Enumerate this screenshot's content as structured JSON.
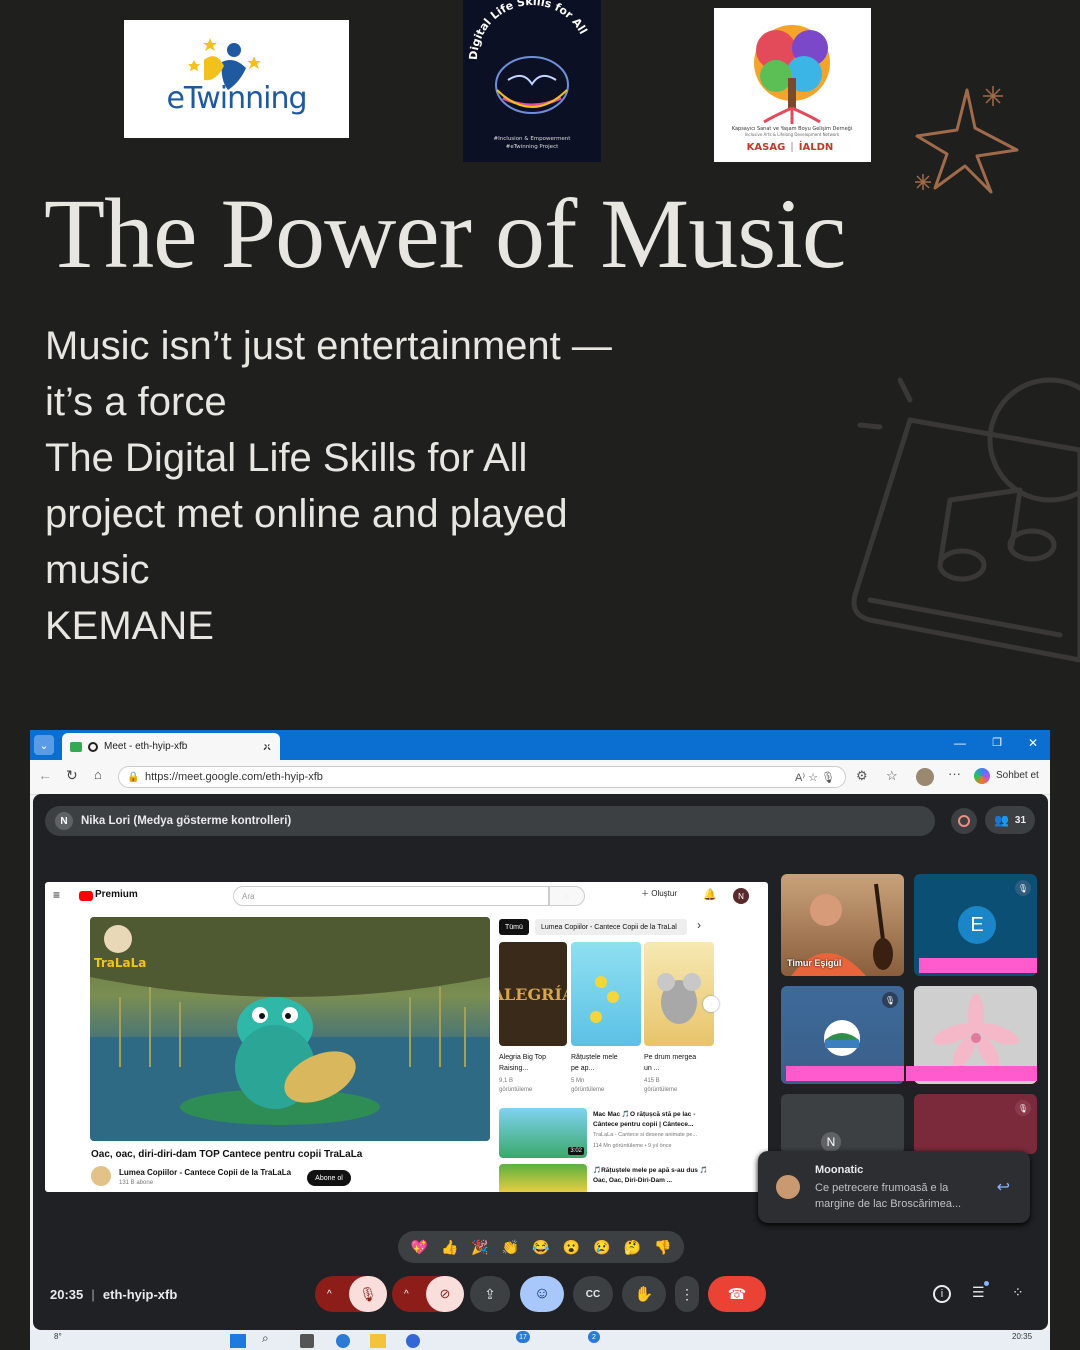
{
  "logos": {
    "etwinning": "eTwinning",
    "dls_title": "Digital Life Skills for All",
    "dls_sub1": "#Inclusion & Empowerment",
    "dls_sub2": "#eTwinning Project",
    "kasag_line": "Kapsayıcı Sanat ve Yaşam Boyu Gelişim Derneği",
    "kasag_sub": "Inclusive Arts & Lifelong Development Network",
    "kasag_left": "KASAG",
    "kasag_right": "İALDN"
  },
  "title": "The Power of Music",
  "body_lines": [
    "Music isn’t just entertainment —",
    "it’s a force",
    "The Digital Life Skills for All",
    "project met online and played",
    "music",
    "KEMANE"
  ],
  "browser": {
    "tab_title": "Meet - eth-hyip-xfb",
    "url": "https://meet.google.com/eth-hyip-xfb",
    "copilot_label": "Sohbet et"
  },
  "meet": {
    "presenter_initial": "N",
    "presenter_label": "Nika Lori (Medya gösterme kontrolleri)",
    "participant_count": "31",
    "time": "20:35",
    "meeting_code": "eth-hyip-xfb",
    "participants": [
      {
        "name": "Timur Eşigül"
      },
      {
        "initial": "E"
      },
      {
        "initial": "N"
      }
    ],
    "reactions": [
      "💖",
      "👍",
      "🎉",
      "👏",
      "😂",
      "😮",
      "😢",
      "🤔",
      "👎"
    ],
    "chat": {
      "sender": "Moonatic",
      "message": "Ce petrecere frumoasă e la margine de lac Broscărimea..."
    }
  },
  "youtube": {
    "brand": "Premium",
    "search_placeholder": "Ara",
    "create_label": "Oluştur",
    "user_initial": "N",
    "chips": [
      "Tümü",
      "Lumea Copiilor - Cantece Copii de la TraLal"
    ],
    "video_title": "Oac, oac, diri-diri-dam TOP Cantece pentru copii TraLaLa",
    "channel_name": "Lumea Copiilor - Cantece Copii de la TraLaLa",
    "subscribers": "131 B abone",
    "subscribe_label": "Abone ol",
    "shorts": [
      {
        "title": "Alegria Big Top Raising...",
        "views": "9,1 B",
        "views_label": "görüntüleme"
      },
      {
        "title": "Rățuștele mele pe ap...",
        "views": "5 Mn",
        "views_label": "görüntüleme"
      },
      {
        "title": "Pe drum mergea un ...",
        "views": "415 B",
        "views_label": "görüntüleme"
      }
    ],
    "recommended": [
      {
        "title": "Mac Mac 🎵O rățușcă stă pe lac - Cântece pentru copii | Cântece...",
        "channel": "TraLaLa - Cantece si desene animate pe...",
        "meta": "114 Mn görüntüleme • 9 yıl önce",
        "duration": "3:02"
      },
      {
        "title": "🎵Rățuștele mele pe apă s-au dus 🎵 Oac, Oac, Diri-Diri-Dam ...",
        "channel": "",
        "meta": ""
      }
    ]
  },
  "taskbar": {
    "temp": "8°",
    "clock": "20:35",
    "badge1": "17",
    "badge2": "2"
  },
  "colors": {
    "background": "#1f1f1d",
    "text": "#e8e6e1",
    "deco": "#8a5a40",
    "meet_bg": "#202124",
    "end_call": "#ea4335",
    "accent_blue": "#0a6fd0",
    "pink_bar": "#ff5bcf"
  }
}
